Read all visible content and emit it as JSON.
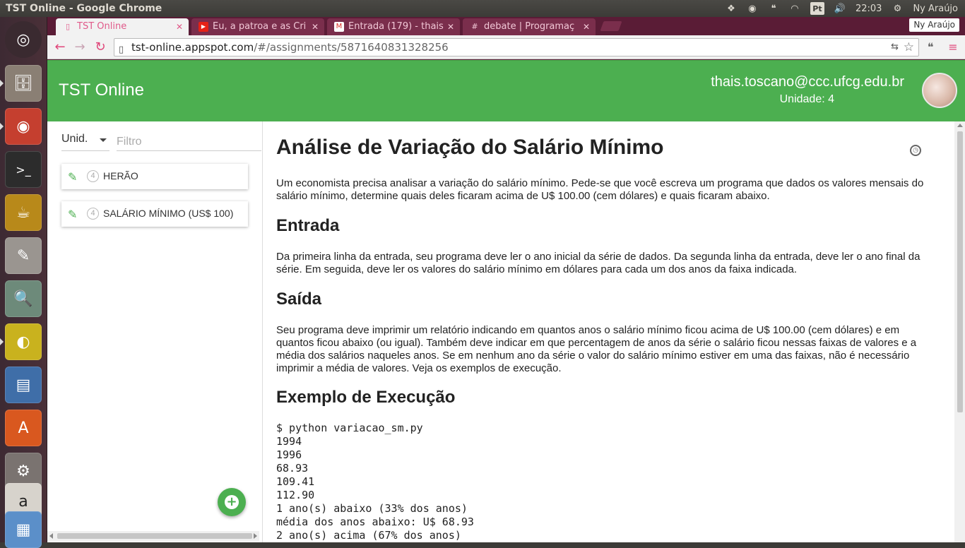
{
  "system": {
    "window_title": "TST Online - Google Chrome",
    "keyboard_layout": "Pt",
    "clock": "22:03",
    "user_name": "Ny Araújo"
  },
  "browser": {
    "tabs": [
      {
        "label": "TST Online",
        "favicon": "page-icon"
      },
      {
        "label": "Eu, a patroa e as Cri",
        "favicon": "youtube-icon"
      },
      {
        "label": "Entrada (179) - thais",
        "favicon": "gmail-icon"
      },
      {
        "label": "debate | Programaç",
        "favicon": "slack-icon"
      }
    ],
    "profile": "Ny Araújo",
    "url_host": "tst-online.appspot.com",
    "url_path": "/#/assignments/5871640831328256"
  },
  "app": {
    "brand": "TST Online",
    "user_email": "thais.toscano@ccc.ufcg.edu.br",
    "unit_label": "Unidade: 4",
    "sidebar": {
      "unit_select": "Unid.",
      "filter_placeholder": "Filtro",
      "items": [
        {
          "unit": "4",
          "label": "HERÃO"
        },
        {
          "unit": "4",
          "label": "SALÁRIO MÍNIMO (US$ 100)"
        }
      ]
    },
    "content": {
      "title": "Análise de Variação do Salário Mínimo",
      "intro": "Um economista precisa analisar a variação do salário mínimo. Pede-se que você escreva um programa que dados os valores mensais do salário mínimo, determine quais deles ficaram acima de U$ 100.00 (cem dólares) e quais ficaram abaixo.",
      "input_heading": "Entrada",
      "input_text": "Da primeira linha da entrada, seu programa deve ler o ano inicial da série de dados. Da segunda linha da entrada, deve ler o ano final da série. Em seguida, deve ler os valores do salário mínimo em dólares para cada um dos anos da faixa indicada.",
      "output_heading": "Saída",
      "output_text": "Seu programa deve imprimir um relatório indicando em quantos anos o salário mínimo ficou acima de U$ 100.00 (cem dólares) e em quantos ficou abaixo (ou igual). Também deve indicar em que percentagem de anos da série o salário ficou nessas faixas de valores e a média dos salários naqueles anos. Se em nenhum ano da série o valor do salário mínimo estiver em uma das faixas, não é necessário imprimir a média de valores. Veja os exemplos de execução.",
      "example_heading": "Exemplo de Execução",
      "example_lines": [
        "$ python variacao_sm.py",
        "1994",
        "1996",
        "68.93",
        "109.41",
        "112.90",
        "1 ano(s) abaixo (33% dos anos)",
        "média dos anos abaixo: U$ 68.93",
        "2 ano(s) acima (67% dos anos)"
      ]
    }
  },
  "colors": {
    "appbar": "#4caf50",
    "tab_accent": "#e05a8a",
    "chrome_frame": "#5a1c36"
  }
}
